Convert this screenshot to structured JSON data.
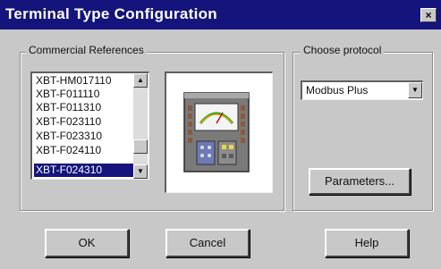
{
  "window": {
    "title": "Terminal Type Configuration",
    "close_glyph": "×"
  },
  "references": {
    "group_label": "Commercial References",
    "items": [
      "XBT-HM017110",
      "XBT-F011110",
      "XBT-F011310",
      "XBT-F023110",
      "XBT-F023310",
      "XBT-F024110",
      "XBT-F024310"
    ],
    "selected_index": 6,
    "scroll_up_glyph": "▲",
    "scroll_down_glyph": "▼"
  },
  "preview": {
    "icon": "terminal-device-icon"
  },
  "protocol": {
    "group_label": "Choose protocol",
    "selected": "Modbus Plus",
    "dropdown_glyph": "▼",
    "parameters_label": "Parameters..."
  },
  "buttons": {
    "ok": "OK",
    "cancel": "Cancel",
    "help": "Help"
  },
  "colors": {
    "title_bar": "#14147c",
    "dialog_bg": "#c8c8c8",
    "selection": "#14147c"
  }
}
